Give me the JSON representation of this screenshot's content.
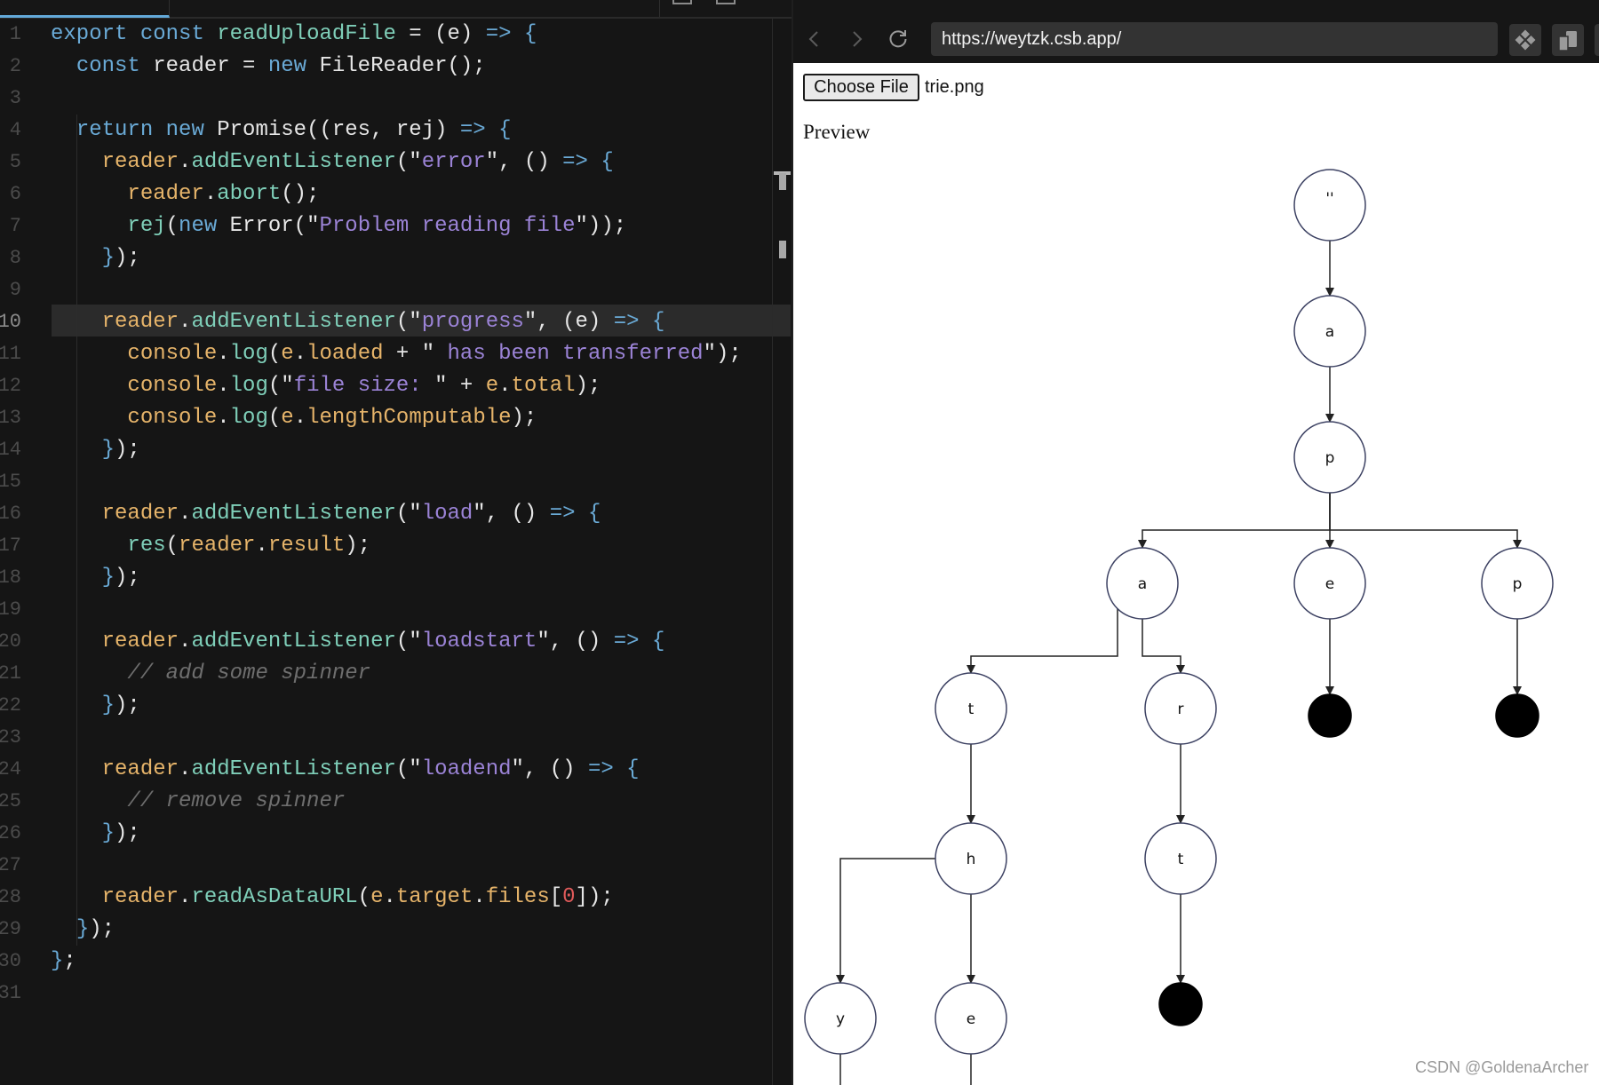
{
  "editor": {
    "active_line": 10,
    "line_numbers": [
      "1",
      "2",
      "3",
      "4",
      "5",
      "6",
      "7",
      "8",
      "9",
      "10",
      "11",
      "12",
      "13",
      "14",
      "15",
      "16",
      "17",
      "18",
      "19",
      "20",
      "21",
      "22",
      "23",
      "24",
      "25",
      "26",
      "27",
      "28",
      "29",
      "30",
      "31"
    ],
    "lines": [
      [
        [
          "kw",
          "export "
        ],
        [
          "kw",
          "const "
        ],
        [
          "fn",
          "readUploadFile"
        ],
        [
          "pl",
          " = (e) "
        ],
        [
          "kw",
          "=> "
        ],
        [
          "br",
          "{"
        ]
      ],
      [
        [
          "pl",
          "  "
        ],
        [
          "kw",
          "const "
        ],
        [
          "pl",
          "reader = "
        ],
        [
          "kw",
          "new "
        ],
        [
          "pl",
          "FileReader();"
        ]
      ],
      [],
      [
        [
          "pl",
          "  "
        ],
        [
          "kw",
          "return "
        ],
        [
          "kw",
          "new "
        ],
        [
          "pl",
          "Promise((res, rej) "
        ],
        [
          "kw",
          "=> "
        ],
        [
          "br",
          "{"
        ]
      ],
      [
        [
          "pl",
          "    "
        ],
        [
          "var",
          "reader"
        ],
        [
          "pl",
          "."
        ],
        [
          "fn",
          "addEventListener"
        ],
        [
          "pl",
          "(\""
        ],
        [
          "str",
          "error"
        ],
        [
          "pl",
          "\", () "
        ],
        [
          "kw",
          "=> "
        ],
        [
          "br",
          "{"
        ]
      ],
      [
        [
          "pl",
          "      "
        ],
        [
          "var",
          "reader"
        ],
        [
          "pl",
          "."
        ],
        [
          "fn",
          "abort"
        ],
        [
          "pl",
          "();"
        ]
      ],
      [
        [
          "pl",
          "      "
        ],
        [
          "fn",
          "rej"
        ],
        [
          "pl",
          "("
        ],
        [
          "kw",
          "new "
        ],
        [
          "pl",
          "Error(\""
        ],
        [
          "str",
          "Problem reading file"
        ],
        [
          "pl",
          "\"));"
        ]
      ],
      [
        [
          "pl",
          "    "
        ],
        [
          "br",
          "}"
        ],
        [
          "pl",
          ");"
        ]
      ],
      [],
      [
        [
          "pl",
          "    "
        ],
        [
          "var",
          "reader"
        ],
        [
          "pl",
          "."
        ],
        [
          "fn",
          "addEventListener"
        ],
        [
          "pl",
          "(\""
        ],
        [
          "str",
          "progress"
        ],
        [
          "pl",
          "\", (e) "
        ],
        [
          "kw",
          "=> "
        ],
        [
          "br",
          "{"
        ]
      ],
      [
        [
          "pl",
          "      "
        ],
        [
          "var",
          "console"
        ],
        [
          "pl",
          "."
        ],
        [
          "fn",
          "log"
        ],
        [
          "pl",
          "("
        ],
        [
          "var",
          "e"
        ],
        [
          "pl",
          "."
        ],
        [
          "var",
          "loaded"
        ],
        [
          "pl",
          " + \""
        ],
        [
          "str",
          " has been transferred"
        ],
        [
          "pl",
          "\");"
        ]
      ],
      [
        [
          "pl",
          "      "
        ],
        [
          "var",
          "console"
        ],
        [
          "pl",
          "."
        ],
        [
          "fn",
          "log"
        ],
        [
          "pl",
          "(\""
        ],
        [
          "str",
          "file size: "
        ],
        [
          "pl",
          "\" + "
        ],
        [
          "var",
          "e"
        ],
        [
          "pl",
          "."
        ],
        [
          "var",
          "total"
        ],
        [
          "pl",
          ");"
        ]
      ],
      [
        [
          "pl",
          "      "
        ],
        [
          "var",
          "console"
        ],
        [
          "pl",
          "."
        ],
        [
          "fn",
          "log"
        ],
        [
          "pl",
          "("
        ],
        [
          "var",
          "e"
        ],
        [
          "pl",
          "."
        ],
        [
          "var",
          "lengthComputable"
        ],
        [
          "pl",
          ");"
        ]
      ],
      [
        [
          "pl",
          "    "
        ],
        [
          "br",
          "}"
        ],
        [
          "pl",
          ");"
        ]
      ],
      [],
      [
        [
          "pl",
          "    "
        ],
        [
          "var",
          "reader"
        ],
        [
          "pl",
          "."
        ],
        [
          "fn",
          "addEventListener"
        ],
        [
          "pl",
          "(\""
        ],
        [
          "str",
          "load"
        ],
        [
          "pl",
          "\", () "
        ],
        [
          "kw",
          "=> "
        ],
        [
          "br",
          "{"
        ]
      ],
      [
        [
          "pl",
          "      "
        ],
        [
          "fn",
          "res"
        ],
        [
          "pl",
          "("
        ],
        [
          "var",
          "reader"
        ],
        [
          "pl",
          "."
        ],
        [
          "var",
          "result"
        ],
        [
          "pl",
          ");"
        ]
      ],
      [
        [
          "pl",
          "    "
        ],
        [
          "br",
          "}"
        ],
        [
          "pl",
          ");"
        ]
      ],
      [],
      [
        [
          "pl",
          "    "
        ],
        [
          "var",
          "reader"
        ],
        [
          "pl",
          "."
        ],
        [
          "fn",
          "addEventListener"
        ],
        [
          "pl",
          "(\""
        ],
        [
          "str",
          "loadstart"
        ],
        [
          "pl",
          "\", () "
        ],
        [
          "kw",
          "=> "
        ],
        [
          "br",
          "{"
        ]
      ],
      [
        [
          "pl",
          "      "
        ],
        [
          "cm",
          "// add some spinner"
        ]
      ],
      [
        [
          "pl",
          "    "
        ],
        [
          "br",
          "}"
        ],
        [
          "pl",
          ");"
        ]
      ],
      [],
      [
        [
          "pl",
          "    "
        ],
        [
          "var",
          "reader"
        ],
        [
          "pl",
          "."
        ],
        [
          "fn",
          "addEventListener"
        ],
        [
          "pl",
          "(\""
        ],
        [
          "str",
          "loadend"
        ],
        [
          "pl",
          "\", () "
        ],
        [
          "kw",
          "=> "
        ],
        [
          "br",
          "{"
        ]
      ],
      [
        [
          "pl",
          "      "
        ],
        [
          "cm",
          "// remove spinner"
        ]
      ],
      [
        [
          "pl",
          "    "
        ],
        [
          "br",
          "}"
        ],
        [
          "pl",
          ");"
        ]
      ],
      [],
      [
        [
          "pl",
          "    "
        ],
        [
          "var",
          "reader"
        ],
        [
          "pl",
          "."
        ],
        [
          "fn",
          "readAsDataURL"
        ],
        [
          "pl",
          "("
        ],
        [
          "var",
          "e"
        ],
        [
          "pl",
          "."
        ],
        [
          "var",
          "target"
        ],
        [
          "pl",
          "."
        ],
        [
          "var",
          "files"
        ],
        [
          "pl",
          "["
        ],
        [
          "num",
          "0"
        ],
        [
          "pl",
          "]);"
        ]
      ],
      [
        [
          "pl",
          "  "
        ],
        [
          "br",
          "}"
        ],
        [
          "pl",
          ");"
        ]
      ],
      [
        [
          "br",
          "}"
        ],
        [
          "pl",
          ";"
        ]
      ],
      []
    ],
    "colors": {
      "keyword": "#6aaad6",
      "function": "#7fcfb9",
      "variable": "#e6b46a",
      "string": "#9b83d6",
      "comment": "#6e6e6e",
      "number": "#e05a5a"
    }
  },
  "browser": {
    "back_icon": "chevron-left-icon",
    "forward_icon": "chevron-right-icon",
    "reload_icon": "reload-icon",
    "url": "https://weytzk.csb.app/",
    "extension_icon": "diamond-grid-icon",
    "copy_icon": "copy-pages-icon",
    "page": {
      "choose_file_label": "Choose File",
      "file_name": "trie.png",
      "preview_label": "Preview"
    }
  },
  "trie": {
    "nodes": [
      {
        "id": "root",
        "label": "''"
      },
      {
        "id": "n_a",
        "label": "a"
      },
      {
        "id": "n_ap",
        "label": "p"
      },
      {
        "id": "n_apa",
        "label": "a"
      },
      {
        "id": "n_ape",
        "label": "e"
      },
      {
        "id": "n_app",
        "label": "p"
      },
      {
        "id": "n_apat",
        "label": "t"
      },
      {
        "id": "n_apar",
        "label": "r"
      },
      {
        "id": "end_ape",
        "label": "",
        "terminal": true
      },
      {
        "id": "end_app",
        "label": "",
        "terminal": true
      },
      {
        "id": "n_apath",
        "label": "h"
      },
      {
        "id": "n_apart",
        "label": "t"
      },
      {
        "id": "end_apart",
        "label": "",
        "terminal": true
      },
      {
        "id": "n_apathy",
        "label": "y"
      },
      {
        "id": "n_apathe",
        "label": "e"
      }
    ],
    "edges": [
      [
        "root",
        "n_a"
      ],
      [
        "n_a",
        "n_ap"
      ],
      [
        "n_ap",
        "n_apa"
      ],
      [
        "n_ap",
        "n_ape"
      ],
      [
        "n_ap",
        "n_app"
      ],
      [
        "n_apa",
        "n_apat"
      ],
      [
        "n_apa",
        "n_apar"
      ],
      [
        "n_ape",
        "end_ape"
      ],
      [
        "n_app",
        "end_app"
      ],
      [
        "n_apat",
        "n_apath"
      ],
      [
        "n_apar",
        "n_apart"
      ],
      [
        "n_apart",
        "end_apart"
      ],
      [
        "n_apath",
        "n_apathy"
      ],
      [
        "n_apath",
        "n_apathe"
      ]
    ]
  },
  "watermark": "CSDN @GoldenaArcher"
}
